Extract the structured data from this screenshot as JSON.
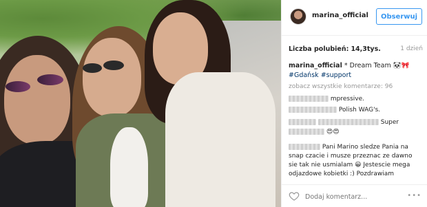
{
  "header": {
    "username": "marina_official",
    "follow_label": "Obserwuj"
  },
  "stats": {
    "likes_label": "Liczba polubień:",
    "likes_value": "14,3tys.",
    "time": "1 dzień"
  },
  "caption": {
    "username": "marina_official",
    "text": "* Dream Team",
    "emoji": "🐼🎀",
    "tags": [
      "#Gdańsk",
      "#support"
    ]
  },
  "comments": {
    "view_all": "zobacz wszystkie komentarze: 96",
    "items": [
      {
        "text": "mpressive."
      },
      {
        "text": "Polish WAG's."
      },
      {
        "text": "Super"
      },
      {
        "text": "😍😍"
      },
      {
        "text": "Pani Marino sledze Pania na snap czacie i musze przeznac ze dawno sie tak nie usmialam 😀 Jestescie mega odjazdowe kobietki :) Pozdrawiam"
      }
    ]
  },
  "footer": {
    "comment_placeholder": "Dodaj komentarz..."
  }
}
